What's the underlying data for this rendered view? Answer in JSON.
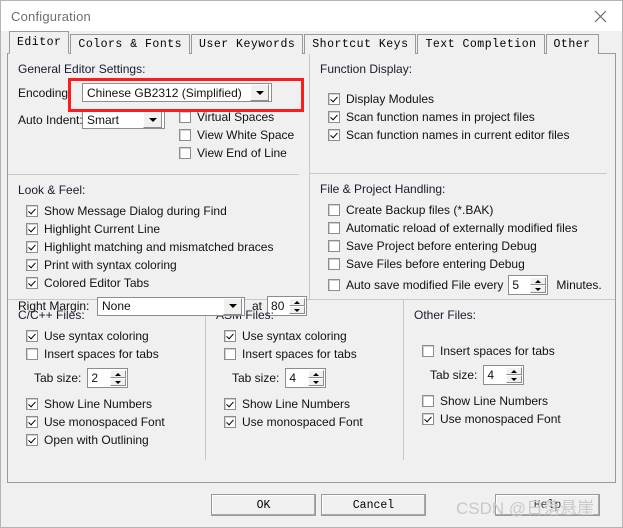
{
  "window": {
    "title": "Configuration",
    "close_icon": "close-icon"
  },
  "tabs": [
    {
      "label": "Editor",
      "active": true
    },
    {
      "label": "Colors & Fonts",
      "active": false
    },
    {
      "label": "User Keywords",
      "active": false
    },
    {
      "label": "Shortcut Keys",
      "active": false
    },
    {
      "label": "Text Completion",
      "active": false
    },
    {
      "label": "Other",
      "active": false
    }
  ],
  "general_editor_settings": {
    "title": "General Editor Settings:",
    "encoding_label": "Encoding:",
    "encoding_value": "Chinese GB2312 (Simplified)",
    "auto_indent_label": "Auto Indent:",
    "auto_indent_value": "Smart",
    "checkboxes": [
      {
        "label": "Virtual Spaces",
        "checked": false
      },
      {
        "label": "View White Space",
        "checked": false
      },
      {
        "label": "View End of Line",
        "checked": false
      }
    ]
  },
  "look_and_feel": {
    "title": "Look & Feel:",
    "checkboxes": [
      {
        "label": "Show Message Dialog during Find",
        "checked": true
      },
      {
        "label": "Highlight Current Line",
        "checked": true
      },
      {
        "label": "Highlight matching and mismatched braces",
        "checked": true
      },
      {
        "label": "Print with syntax coloring",
        "checked": true
      },
      {
        "label": "Colored Editor Tabs",
        "checked": true
      }
    ],
    "right_margin_label": "Right Margin:",
    "right_margin_value": "None",
    "at_label": "at",
    "at_value": "80"
  },
  "function_display": {
    "title": "Function Display:",
    "checkboxes": [
      {
        "label": "Display Modules",
        "checked": true
      },
      {
        "label": "Scan function names in project files",
        "checked": true
      },
      {
        "label": "Scan function names in current editor files",
        "checked": true
      }
    ]
  },
  "file_project_handling": {
    "title": "File & Project Handling:",
    "checkboxes": [
      {
        "label": "Create Backup files (*.BAK)",
        "checked": false
      },
      {
        "label": "Automatic reload of externally modified files",
        "checked": false
      },
      {
        "label": "Save Project before entering Debug",
        "checked": false
      },
      {
        "label": "Save Files before entering Debug",
        "checked": false
      }
    ],
    "autosave_label": "Auto save modified File every",
    "autosave_checked": false,
    "autosave_value": "5",
    "autosave_suffix": "Minutes."
  },
  "c_cpp_files": {
    "title": "C/C++ Files:",
    "checkboxes_top": [
      {
        "label": "Use syntax coloring",
        "checked": true
      },
      {
        "label": "Insert spaces for tabs",
        "checked": false
      }
    ],
    "tab_size_label": "Tab size:",
    "tab_size_value": "2",
    "checkboxes_bottom": [
      {
        "label": "Show Line Numbers",
        "checked": true
      },
      {
        "label": "Use monospaced Font",
        "checked": true
      },
      {
        "label": "Open with Outlining",
        "checked": true
      }
    ]
  },
  "asm_files": {
    "title": "ASM Files:",
    "checkboxes_top": [
      {
        "label": "Use syntax coloring",
        "checked": true
      },
      {
        "label": "Insert spaces for tabs",
        "checked": false
      }
    ],
    "tab_size_label": "Tab size:",
    "tab_size_value": "4",
    "checkboxes_bottom": [
      {
        "label": "Show Line Numbers",
        "checked": true
      },
      {
        "label": "Use monospaced Font",
        "checked": true
      }
    ]
  },
  "other_files": {
    "title": "Other Files:",
    "checkboxes_top": [
      {
        "label": "Insert spaces for tabs",
        "checked": false
      }
    ],
    "tab_size_label": "Tab size:",
    "tab_size_value": "4",
    "checkboxes_bottom": [
      {
        "label": "Show Line Numbers",
        "checked": false
      },
      {
        "label": "Use monospaced Font",
        "checked": true
      }
    ]
  },
  "footer": {
    "ok_label": "OK",
    "cancel_label": "Cancel",
    "help_label": "Help",
    "watermark": "CSDN @日落悬崖"
  },
  "colors": {
    "highlight": "#fb1d1d",
    "dialog_bg": "#f0f0f0"
  }
}
